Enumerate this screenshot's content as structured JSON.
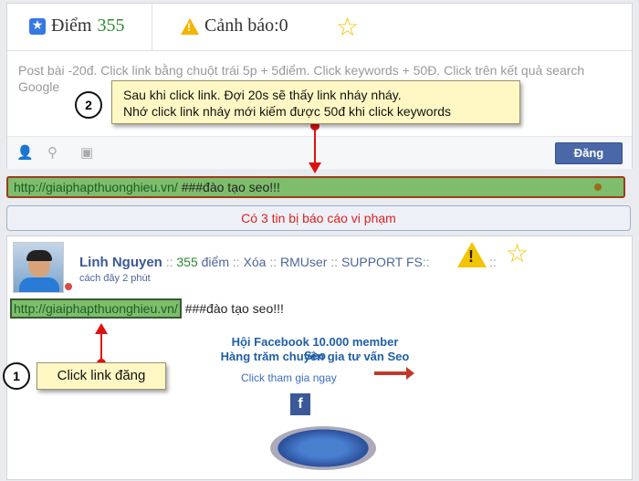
{
  "header": {
    "points_label": "Điểm",
    "points_value": "355",
    "warnings_label": "Cảnh báo:",
    "warnings_value": "0"
  },
  "composer": {
    "text": "Post bài -20đ. Click link bằng chuột trái 5p  + 5điểm. Click keywords + 50Đ. Click trên kết quả search Google",
    "post_button": "Đăng",
    "icons": [
      "add-friend-icon",
      "location-icon",
      "camera-icon"
    ]
  },
  "link_bar": {
    "url": "http://giaiphapthuonghieu.vn/",
    "text": " ###đào tạo seo!!!"
  },
  "report_bar": {
    "text": "Có 3 tin bị báo cáo vi phạm"
  },
  "post": {
    "author": "Linh Nguyen",
    "sep1": " :: ",
    "points": "355",
    "points_label": " điểm",
    "sep2": " :: ",
    "delete": "Xóa",
    "sep3": " :: ",
    "rmuser": "RMUser",
    "sep4": " :: ",
    "support": "SUPPORT FS",
    "sep5": "::",
    "sep6": "::",
    "time": "cách đây 2 phút",
    "url": "http://giaiphapthuonghieu.vn/",
    "text": " ###đào tạo seo!!!"
  },
  "promo": {
    "line1": "Hội Facebook 10.000 member Seo",
    "line2": "Hàng trăm chuyên gia tư vấn Seo",
    "line3": "Click tham gia ngay",
    "fb_letter": "f"
  },
  "annotations": {
    "top_number": "2",
    "top_line1": "Sau khi click link. Đợi 20s sẽ thấy link nháy nháy.",
    "top_line2": "Nhớ click link nháy mới kiếm được 50đ khi click keywords",
    "bottom_number": "1",
    "bottom_text": "Click link đăng"
  },
  "colors": {
    "link_highlight": "#7dbd6c",
    "report_text": "#e02020",
    "annotation_bg": "#fff8c4",
    "arrow": "#dd1111"
  }
}
